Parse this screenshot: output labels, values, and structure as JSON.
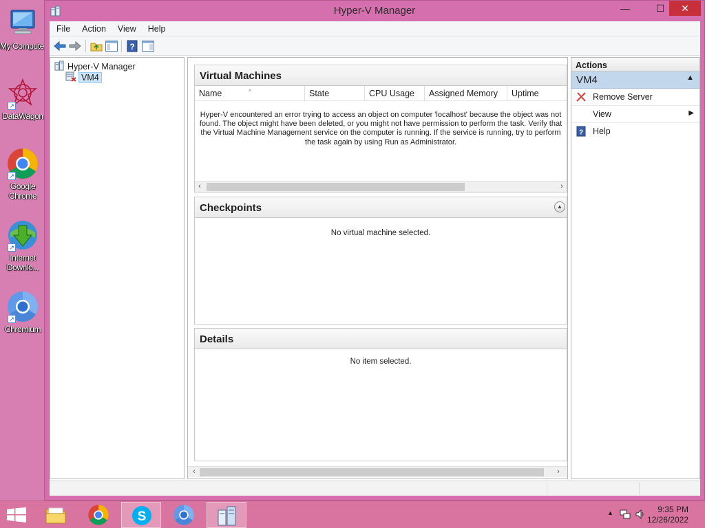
{
  "desktop": {
    "icons": [
      {
        "label": "My Computer",
        "icon": "computer-icon"
      },
      {
        "label": "DataWagon",
        "icon": "datawagon-icon"
      },
      {
        "label": "Google Chrome",
        "line1": "Google",
        "line2": "Chrome",
        "icon": "chrome-icon"
      },
      {
        "label": "Internet Downloader",
        "line1": "Internet",
        "line2": "Downlo...",
        "icon": "idm-icon"
      },
      {
        "label": "Chromium",
        "icon": "chromium-icon"
      }
    ]
  },
  "window": {
    "title": "Hyper-V Manager",
    "controls": {
      "minimize": "—",
      "maximize": "☐",
      "close": "✕"
    }
  },
  "menu": {
    "file": "File",
    "action": "Action",
    "view": "View",
    "help": "Help"
  },
  "toolbar": {
    "buttons": [
      "back-arrow-icon",
      "forward-arrow-icon",
      "up-folder-icon",
      "show-hide-console-tree-icon",
      "help-icon",
      "show-hide-action-pane-icon"
    ]
  },
  "tree": {
    "root": "Hyper-V Manager",
    "child": "VM4"
  },
  "virtual_machines": {
    "title": "Virtual Machines",
    "columns": [
      "Name",
      "State",
      "CPU Usage",
      "Assigned Memory",
      "Uptime"
    ],
    "error": "Hyper-V encountered an error trying to access an object on computer 'localhost' because the object was not found. The object might have been deleted, or you might not have permission to perform the task. Verify that the Virtual Machine Management service on the computer is running. If the service is running, try to perform the task again by using Run as Administrator."
  },
  "checkpoints": {
    "title": "Checkpoints",
    "message": "No virtual machine selected."
  },
  "details": {
    "title": "Details",
    "message": "No item selected."
  },
  "actions": {
    "header": "Actions",
    "group": "VM4",
    "items": [
      {
        "label": "Remove Server",
        "icon": "remove-x-icon"
      },
      {
        "label": "View",
        "icon": "",
        "submenu": true
      },
      {
        "label": "Help",
        "icon": "help-icon"
      }
    ]
  },
  "taskbar": {
    "apps": [
      "file-explorer-icon",
      "chrome-icon",
      "skype-icon",
      "chromium-icon",
      "hyper-v-manager-icon"
    ],
    "time": "9:35 PM",
    "date": "12/26/2022"
  },
  "colors": {
    "desktop": "#d77fb2",
    "window_frame": "#d66fae",
    "action_group": "#c2d7ec",
    "close_button": "#c7303a"
  }
}
